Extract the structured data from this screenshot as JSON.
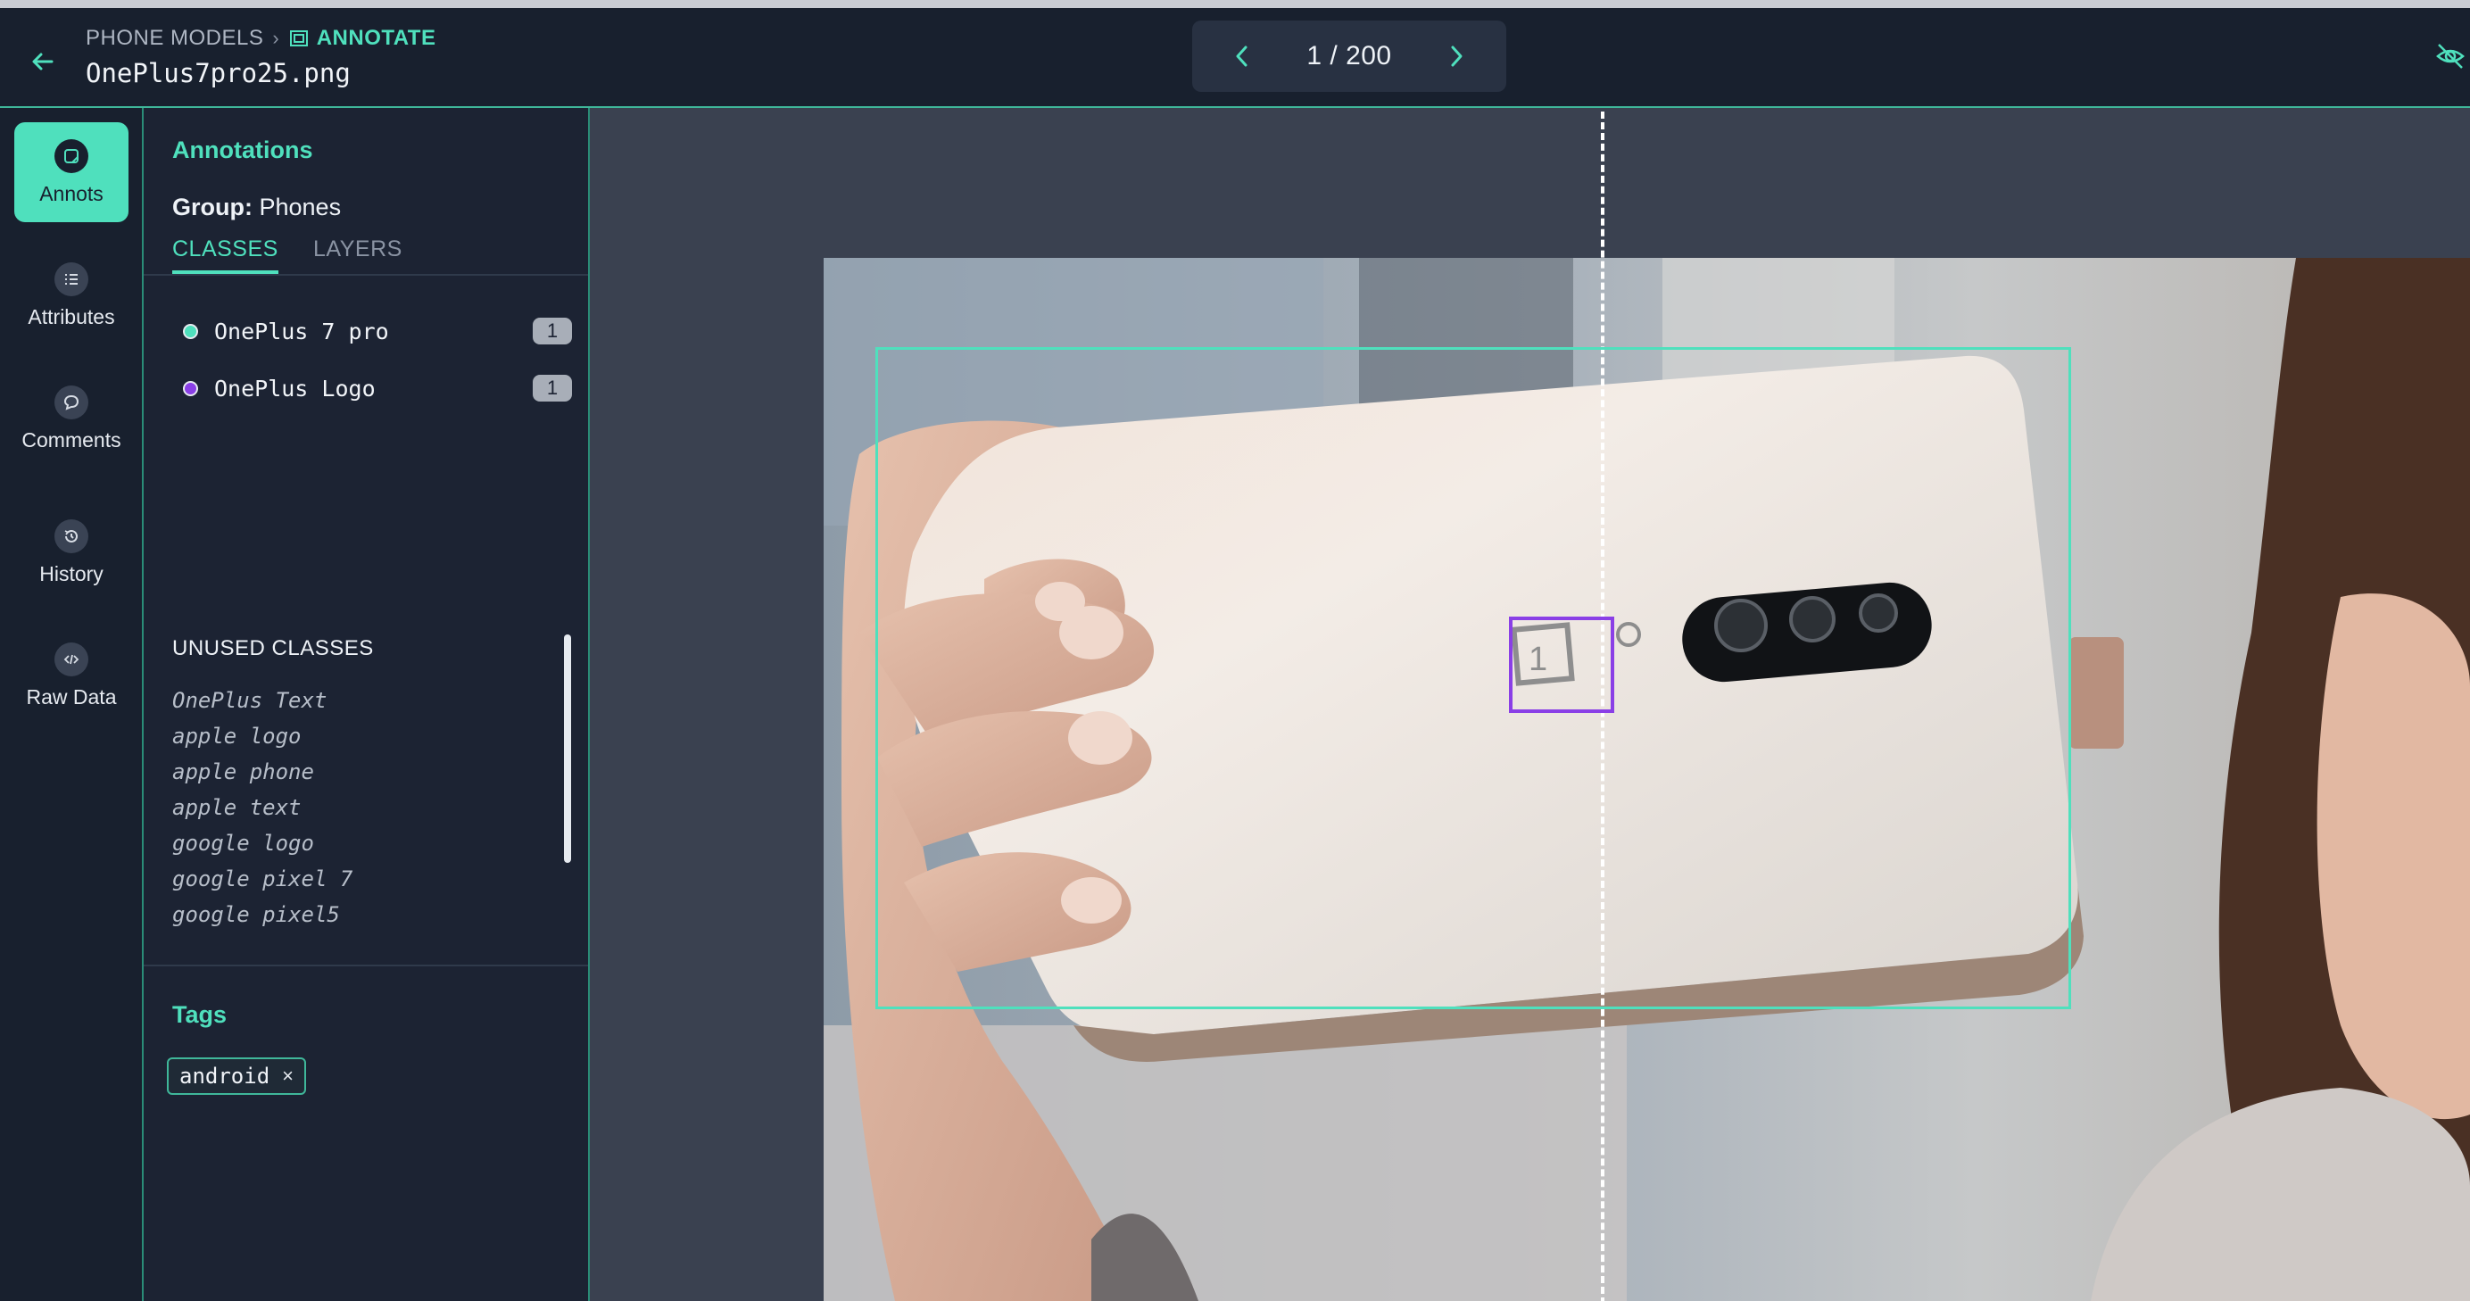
{
  "header": {
    "breadcrumb_project": "PHONE MODELS",
    "breadcrumb_separator": "›",
    "breadcrumb_active": "ANNOTATE",
    "filename": "OnePlus7pro25.png",
    "pager": "1 / 200"
  },
  "nav": {
    "items": [
      {
        "label": "Annots",
        "icon": "annotation-icon",
        "active": true
      },
      {
        "label": "Attributes",
        "icon": "list-icon",
        "active": false
      },
      {
        "label": "Comments",
        "icon": "comment-icon",
        "active": false
      },
      {
        "label": "History",
        "icon": "history-icon",
        "active": false
      },
      {
        "label": "Raw Data",
        "icon": "code-icon",
        "active": false
      }
    ]
  },
  "panel": {
    "title": "Annotations",
    "group_label": "Group:",
    "group_value": "Phones",
    "tabs": [
      "CLASSES",
      "LAYERS"
    ],
    "classes": [
      {
        "name": "OnePlus 7 pro",
        "count": "1",
        "color": "#4fe0bd"
      },
      {
        "name": "OnePlus Logo",
        "count": "1",
        "color": "#8a3fe6"
      }
    ],
    "unused_title": "UNUSED CLASSES",
    "unused": [
      "OnePlus Text",
      "apple logo",
      "apple phone",
      "apple text",
      "google logo",
      "google pixel 7",
      "google pixel5"
    ],
    "tags_title": "Tags",
    "tags": [
      "android"
    ],
    "tag_remove": "×"
  },
  "colors": {
    "accent": "#4fe0bd",
    "logo_box": "#8a3fe6",
    "background": "#1c2333"
  }
}
